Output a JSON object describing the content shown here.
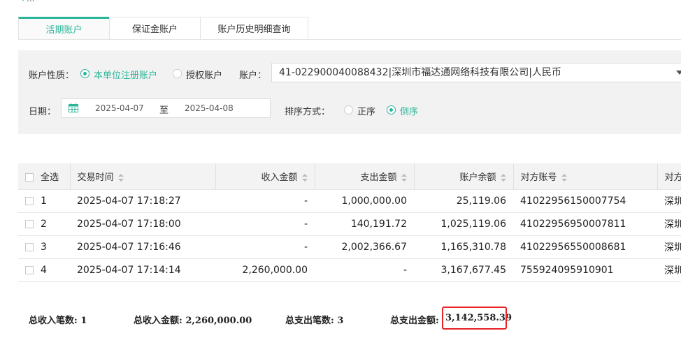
{
  "header_fragment": "...",
  "tabs": [
    {
      "label": "活期账户",
      "active": true
    },
    {
      "label": "保证金账户",
      "active": false
    },
    {
      "label": "账户历史明细查询",
      "active": false
    }
  ],
  "filter": {
    "account_type_label": "账户性质：",
    "account_type_options": [
      "本单位注册账户",
      "授权账户"
    ],
    "account_type_selected": "本单位注册账户",
    "account_label": "账户：",
    "account_value": "41-022900040088432|深圳市福达通网络科技有限公司|人民币",
    "date_label": "日期：",
    "date_from": "2025-04-07",
    "date_to_label": "至",
    "date_to": "2025-04-08",
    "sort_label": "排序方式：",
    "sort_options": [
      "正序",
      "倒序"
    ],
    "sort_selected": "倒序"
  },
  "table": {
    "headers": [
      "全选",
      "交易时间",
      "收入金额",
      "支出金额",
      "账户余额",
      "对方账号",
      "对方"
    ],
    "rows": [
      {
        "no": "1",
        "time": "2025-04-07 17:18:27",
        "income": "-",
        "expense": "1,000,000.00",
        "balance": "25,119.06",
        "counter_account": "41022956150007754",
        "counter_name": "深圳"
      },
      {
        "no": "2",
        "time": "2025-04-07 17:18:00",
        "income": "-",
        "expense": "140,191.72",
        "balance": "1,025,119.06",
        "counter_account": "41022956950007811",
        "counter_name": "深圳"
      },
      {
        "no": "3",
        "time": "2025-04-07 17:16:46",
        "income": "-",
        "expense": "2,002,366.67",
        "balance": "1,165,310.78",
        "counter_account": "41022956550008681",
        "counter_name": "深圳"
      },
      {
        "no": "4",
        "time": "2025-04-07 17:14:14",
        "income": "2,260,000.00",
        "expense": "-",
        "balance": "3,167,677.45",
        "counter_account": "755924095910901",
        "counter_name": "深圳"
      }
    ]
  },
  "summary": {
    "income_count": "总收入笔数: 1",
    "income_amount": "总收入金额: 2,260,000.00",
    "expense_count": "总支出笔数: 3",
    "expense_amount_label": "总支出金额:",
    "expense_amount": "3,142,558.39"
  },
  "colors": {
    "accent": "#2bb59a",
    "highlight_box": "#e8232a"
  }
}
